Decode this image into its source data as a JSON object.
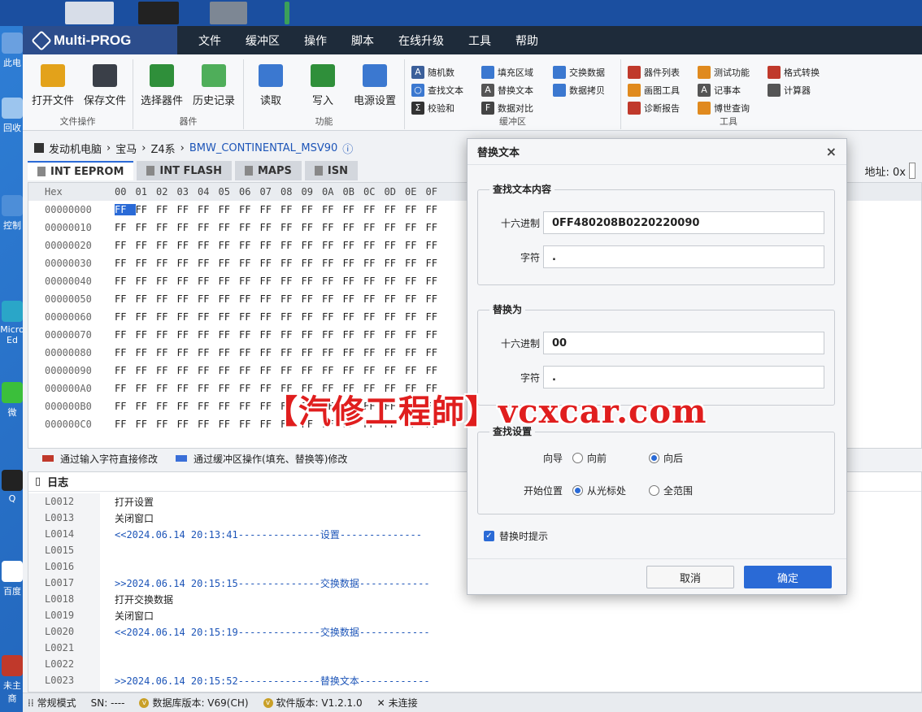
{
  "app": {
    "title": "Multi-PROG"
  },
  "menu": [
    "文件",
    "缓冲区",
    "操作",
    "脚本",
    "在线升级",
    "工具",
    "帮助"
  ],
  "desktop_labels": [
    "此电",
    "回收",
    "控制",
    "Micro Ed",
    "微",
    "Q",
    "百度",
    "未主商"
  ],
  "ribbon": {
    "groups": {
      "file": {
        "label": "文件操作",
        "buttons": [
          "打开文件",
          "保存文件"
        ]
      },
      "device": {
        "label": "器件",
        "buttons": [
          "选择器件",
          "历史记录"
        ]
      },
      "func": {
        "label": "功能",
        "buttons": [
          "读取",
          "写入",
          "电源设置"
        ]
      },
      "buffer": {
        "label": "缓冲区",
        "items": [
          "随机数",
          "查找文本",
          "校验和",
          "填充区域",
          "替换文本",
          "数据对比",
          "交换数据",
          "数据拷贝"
        ]
      },
      "tools": {
        "label": "工具",
        "items": [
          "器件列表",
          "画图工具",
          "诊断报告",
          "测试功能",
          "记事本",
          "博世查询",
          "格式转换",
          "计算器"
        ]
      }
    }
  },
  "breadcrumb": [
    "发动机电脑",
    "宝马",
    "Z4系",
    "BMW_CONTINENTAL_MSV90"
  ],
  "tabs": [
    "INT EEPROM",
    "INT FLASH",
    "MAPS",
    "ISN"
  ],
  "address": {
    "label": "地址: 0x"
  },
  "hex": {
    "header_label": "Hex",
    "columns": [
      "00",
      "01",
      "02",
      "03",
      "04",
      "05",
      "06",
      "07",
      "08",
      "09",
      "0A",
      "0B",
      "0C",
      "0D",
      "0E",
      "0F"
    ],
    "offsets": [
      "00000000",
      "00000010",
      "00000020",
      "00000030",
      "00000040",
      "00000050",
      "00000060",
      "00000070",
      "00000080",
      "00000090",
      "000000A0",
      "000000B0",
      "000000C0"
    ],
    "byte": "FF"
  },
  "legend": {
    "red": "通过输入字符直接修改",
    "blue": "通过缓冲区操作(填充、替换等)修改",
    "red_color": "#c0392b",
    "blue_color": "#3a6fd8"
  },
  "log": {
    "title": "日志",
    "lines": [
      {
        "n": "L0012",
        "t": "打开设置",
        "blue": false
      },
      {
        "n": "L0013",
        "t": "关闭窗口",
        "blue": false
      },
      {
        "n": "L0014",
        "t": "<<2024.06.14 20:13:41--------------设置--------------",
        "blue": true
      },
      {
        "n": "L0015",
        "t": "",
        "blue": false
      },
      {
        "n": "L0016",
        "t": "",
        "blue": false
      },
      {
        "n": "L0017",
        "t": ">>2024.06.14 20:15:15--------------交换数据------------",
        "blue": true
      },
      {
        "n": "L0018",
        "t": "打开交换数据",
        "blue": false
      },
      {
        "n": "L0019",
        "t": "关闭窗口",
        "blue": false
      },
      {
        "n": "L0020",
        "t": "<<2024.06.14 20:15:19--------------交换数据------------",
        "blue": true
      },
      {
        "n": "L0021",
        "t": "",
        "blue": false
      },
      {
        "n": "L0022",
        "t": "",
        "blue": false
      },
      {
        "n": "L0023",
        "t": ">>2024.06.14 20:15:52--------------替换文本------------",
        "blue": true
      }
    ]
  },
  "status": {
    "mode": "常规模式",
    "sn": "SN: ----",
    "db": "数据库版本: V69(CH)",
    "sw": "软件版本: V1.2.1.0",
    "conn": "未连接"
  },
  "dialog": {
    "title": "替换文本",
    "find": {
      "legend": "查找文本内容",
      "hex_label": "十六进制",
      "hex_value": "0FF480208B0220220090",
      "char_label": "字符",
      "char_value": "."
    },
    "replace": {
      "legend": "替换为",
      "hex_label": "十六进制",
      "hex_value": "00",
      "char_label": "字符",
      "char_value": "."
    },
    "settings": {
      "legend": "查找设置",
      "dir_label": "向导",
      "dir_fwd": "向前",
      "dir_back": "向后",
      "start_label": "开始位置",
      "start_cursor": "从光标处",
      "start_all": "全范围"
    },
    "prompt": "替换时提示",
    "cancel": "取消",
    "ok": "确定"
  },
  "watermark": "【汽修工程師】vcxcar.com"
}
